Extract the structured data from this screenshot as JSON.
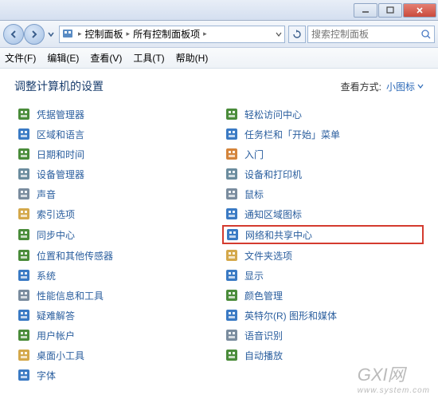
{
  "titlebar": {
    "minimize": "—",
    "maximize": "□",
    "close": "✕"
  },
  "navbar": {
    "breadcrumb": [
      "控制面板",
      "所有控制面板项"
    ],
    "search_placeholder": "搜索控制面板"
  },
  "menubar": {
    "items": [
      "文件(F)",
      "编辑(E)",
      "查看(V)",
      "工具(T)",
      "帮助(H)"
    ]
  },
  "content": {
    "title": "调整计算机的设置",
    "view_label": "查看方式:",
    "view_value": "小图标"
  },
  "items_left": [
    {
      "name": "credential-manager",
      "label": "凭据管理器",
      "color": "#4a8c3a"
    },
    {
      "name": "region-language",
      "label": "区域和语言",
      "color": "#3a7ac4"
    },
    {
      "name": "date-time",
      "label": "日期和时间",
      "color": "#4a8c3a"
    },
    {
      "name": "device-manager",
      "label": "设备管理器",
      "color": "#6b8c9e"
    },
    {
      "name": "sound",
      "label": "声音",
      "color": "#7a8c9e"
    },
    {
      "name": "indexing-options",
      "label": "索引选项",
      "color": "#d4a84a"
    },
    {
      "name": "sync-center",
      "label": "同步中心",
      "color": "#4a8c3a"
    },
    {
      "name": "location-sensors",
      "label": "位置和其他传感器",
      "color": "#4a8c3a"
    },
    {
      "name": "system",
      "label": "系统",
      "color": "#3a7ac4"
    },
    {
      "name": "performance-tools",
      "label": "性能信息和工具",
      "color": "#7a8c9e"
    },
    {
      "name": "troubleshooting",
      "label": "疑难解答",
      "color": "#3a7ac4"
    },
    {
      "name": "user-accounts",
      "label": "用户帐户",
      "color": "#4a8c3a"
    },
    {
      "name": "desktop-gadgets",
      "label": "桌面小工具",
      "color": "#d4a84a"
    },
    {
      "name": "fonts",
      "label": "字体",
      "color": "#3a7ac4"
    }
  ],
  "items_right": [
    {
      "name": "ease-of-access",
      "label": "轻松访问中心",
      "color": "#4a8c3a"
    },
    {
      "name": "taskbar-start",
      "label": "任务栏和「开始」菜单",
      "color": "#3a7ac4"
    },
    {
      "name": "getting-started",
      "label": "入门",
      "color": "#d4843a"
    },
    {
      "name": "devices-printers",
      "label": "设备和打印机",
      "color": "#6b8c9e"
    },
    {
      "name": "mouse",
      "label": "鼠标",
      "color": "#7a8c9e"
    },
    {
      "name": "notification-icons",
      "label": "通知区域图标",
      "color": "#3a7ac4"
    },
    {
      "name": "network-sharing",
      "label": "网络和共享中心",
      "color": "#3a7ac4",
      "highlighted": true
    },
    {
      "name": "folder-options",
      "label": "文件夹选项",
      "color": "#d4a84a"
    },
    {
      "name": "display",
      "label": "显示",
      "color": "#3a7ac4"
    },
    {
      "name": "color-management",
      "label": "颜色管理",
      "color": "#4a8c3a"
    },
    {
      "name": "intel-graphics",
      "label": "英特尔(R) 图形和媒体",
      "color": "#3a7ac4"
    },
    {
      "name": "speech-recognition",
      "label": "语音识别",
      "color": "#7a8c9e"
    },
    {
      "name": "autoplay",
      "label": "自动播放",
      "color": "#4a8c3a"
    }
  ],
  "watermark": {
    "main": "GXI网",
    "sub": "www.system.com"
  }
}
